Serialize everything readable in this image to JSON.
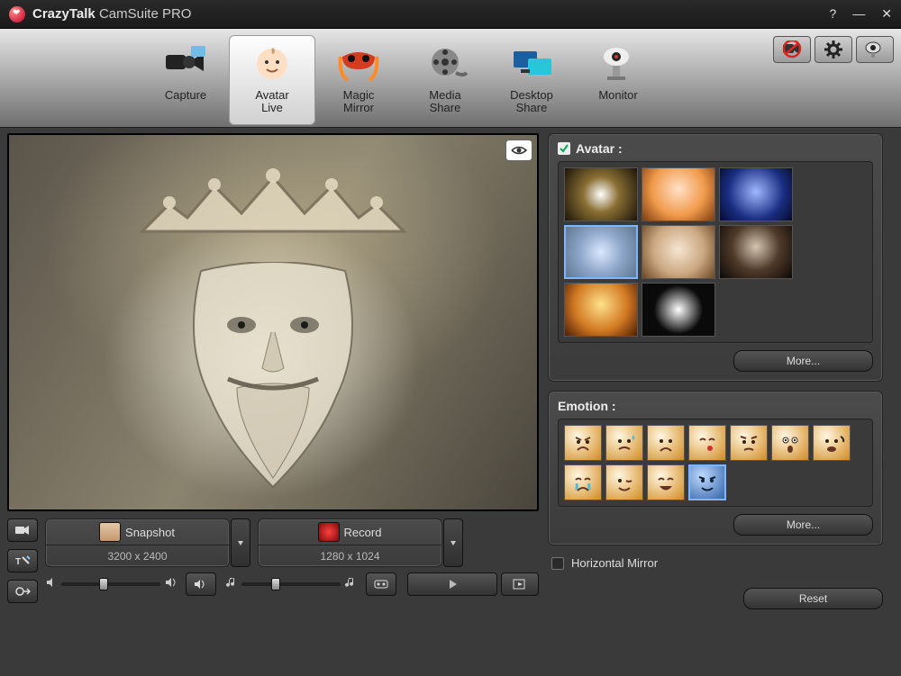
{
  "title": {
    "brand_bold": "CrazyTalk",
    "brand_light": "CamSuite ",
    "edition": "PRO"
  },
  "modes": {
    "capture": "Capture",
    "avatarlive": "Avatar\nLive",
    "magicmirror": "Magic\nMirror",
    "mediashare": "Media\nShare",
    "desktopshare": "Desktop\nShare",
    "monitor": "Monitor"
  },
  "snapshot": {
    "label": "Snapshot",
    "resolution": "3200 x 2400"
  },
  "record": {
    "label": "Record",
    "resolution": "1280 x 1024"
  },
  "avatar": {
    "header": "Avatar :",
    "more": "More..."
  },
  "emotion": {
    "header": "Emotion :",
    "more": "More..."
  },
  "hmirror": "Horizontal Mirror",
  "reset": "Reset"
}
